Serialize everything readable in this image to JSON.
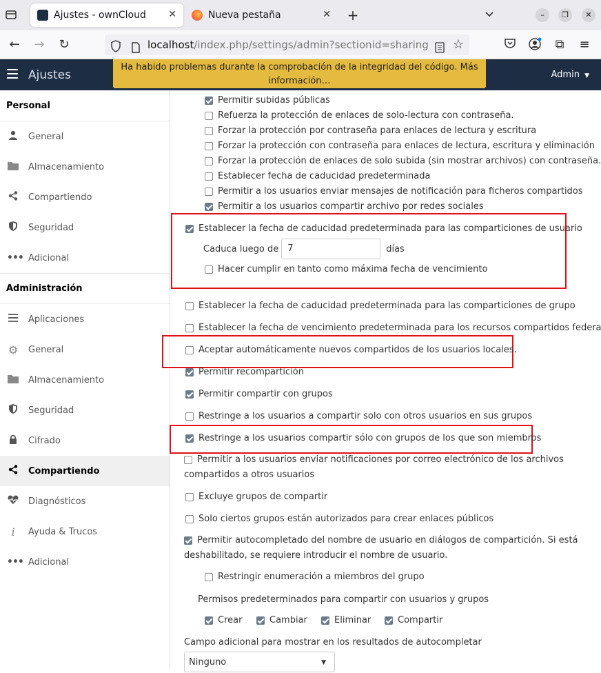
{
  "browser": {
    "tabs": [
      {
        "title": "Ajustes - ownCloud",
        "active": true
      },
      {
        "title": "Nueva pestaña",
        "active": false
      }
    ],
    "url": {
      "host": "localhost",
      "path": "/index.php/settings/admin?sectionid=sharing"
    }
  },
  "header": {
    "app_title": "Ajustes",
    "user": "Admin",
    "warning_line1": "Ha habido problemas durante la comprobación de la integridad del código. Más",
    "warning_line2": "información…"
  },
  "sidebar": {
    "personal_title": "Personal",
    "personal_items": [
      {
        "label": "General",
        "icon": "user-icon"
      },
      {
        "label": "Almacenamiento",
        "icon": "folder-icon"
      },
      {
        "label": "Compartiendo",
        "icon": "share-icon"
      },
      {
        "label": "Seguridad",
        "icon": "shield-icon"
      },
      {
        "label": "Adicional",
        "icon": "more-icon"
      }
    ],
    "admin_title": "Administración",
    "admin_items": [
      {
        "label": "Aplicaciones",
        "icon": "list-icon"
      },
      {
        "label": "General",
        "icon": "gear-icon"
      },
      {
        "label": "Almacenamiento",
        "icon": "folder-icon"
      },
      {
        "label": "Seguridad",
        "icon": "shield-icon"
      },
      {
        "label": "Cifrado",
        "icon": "lock-icon"
      },
      {
        "label": "Compartiendo",
        "icon": "share-icon",
        "active": true
      },
      {
        "label": "Diagnósticos",
        "icon": "heartbeat-icon"
      },
      {
        "label": "Ayuda & Trucos",
        "icon": "info-icon"
      },
      {
        "label": "Adicional",
        "icon": "more-icon"
      }
    ]
  },
  "settings": {
    "o1": {
      "label": "Permitir subidas públicas",
      "checked": true
    },
    "o2": {
      "label": "Refuerza la protección de enlaces de solo-lectura con contraseña.",
      "checked": false
    },
    "o3": {
      "label": "Forzar la protección por contraseña para enlaces de lectura y escritura",
      "checked": false
    },
    "o4": {
      "label": "Forzar la protección con contraseña para enlaces de lectura, escritura y eliminación",
      "checked": false
    },
    "o5": {
      "label": "Forzar la protección de enlaces de solo subida (sin mostrar archivos) con contraseña.",
      "checked": false
    },
    "o6": {
      "label": "Establecer fecha de caducidad predeterminada",
      "checked": false
    },
    "o7": {
      "label": "Permitir a los usuarios enviar mensajes de notificación para ficheros compartidos",
      "checked": false
    },
    "o8": {
      "label": "Permitir a los usuarios compartir archivo por redes sociales",
      "checked": true
    },
    "o9": {
      "label": "Establecer la fecha de caducidad predeterminada para las comparticiones de usuario",
      "checked": true
    },
    "expire_prefix": "Caduca luego de",
    "expire_value": "7",
    "expire_suffix": "días",
    "o10": {
      "label": "Hacer cumplir en tanto como máxima fecha de vencimiento",
      "checked": false
    },
    "o11": {
      "label": "Establecer la fecha de caducidad predeterminada para las comparticiones de grupo",
      "checked": false
    },
    "o12": {
      "label": "Establecer la fecha de vencimiento predeterminada para los recursos compartidos federados",
      "checked": false
    },
    "o13": {
      "label": "Aceptar automáticamente nuevos compartidos de los usuarios locales.",
      "checked": false
    },
    "o14": {
      "label": "Permitir recompartición",
      "checked": true
    },
    "o15": {
      "label": "Permitir compartir con grupos",
      "checked": true
    },
    "o16": {
      "label": "Restringe a los usuarios a compartir solo con otros usuarios en sus grupos",
      "checked": false
    },
    "o17": {
      "label": "Restringe a los usuarios compartir sólo con grupos de los que son miembros",
      "checked": true
    },
    "o18_line1": "Permitir a los usuarios enviar notificaciones por correo electrónico de los archivos",
    "o18_line2": "compartidos a otros usuarios",
    "o18_checked": false,
    "o19": {
      "label": "Excluye grupos de compartir",
      "checked": false
    },
    "o20": {
      "label": "Solo ciertos grupos están autorizados para crear enlaces públicos",
      "checked": false
    },
    "o21_line1": "Permitir autocompletado del nombre de usuario en diálogos de compartición. Si está",
    "o21_line2": "deshabilitado, se requiere introducir el nombre de usuario.",
    "o21_checked": true,
    "o22": {
      "label": "Restringir enumeración a miembros del grupo",
      "checked": false
    },
    "perms_title": "Permisos predeterminados para compartir con usuarios y grupos",
    "perms": [
      {
        "label": "Crear",
        "checked": true
      },
      {
        "label": "Cambiar",
        "checked": true
      },
      {
        "label": "Eliminar",
        "checked": true
      },
      {
        "label": "Compartir",
        "checked": true
      }
    ],
    "extra_field_label": "Campo adicional para mostrar en los resultados de autocompletar",
    "extra_field_value": "Ninguno"
  }
}
